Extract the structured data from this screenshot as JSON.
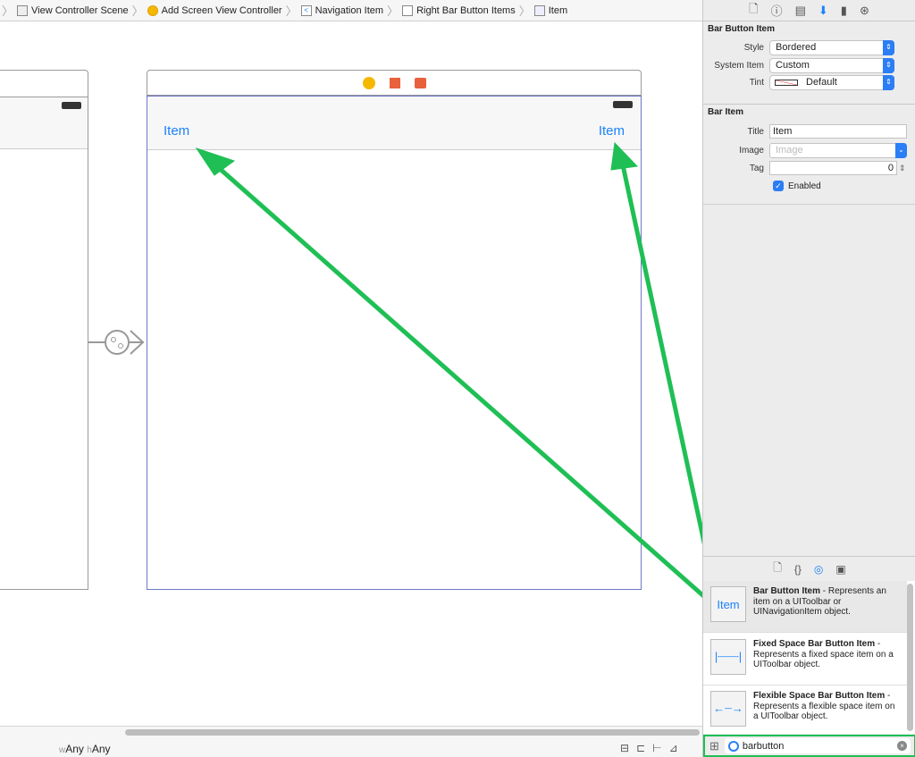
{
  "breadcrumb": [
    "View Controller Scene",
    "Add Screen View Controller",
    "Navigation Item",
    "Right Bar Button Items",
    "Item"
  ],
  "canvas": {
    "left_nav_item": "Item",
    "right_nav_item": "Item"
  },
  "inspector": {
    "tabs": [
      "file-icon",
      "help-icon",
      "identity-icon",
      "attributes-icon",
      "size-icon",
      "connections-icon"
    ],
    "active_tab": "attributes-icon",
    "bar_button_item": {
      "title": "Bar Button Item",
      "style_label": "Style",
      "style": "Bordered",
      "system_item_label": "System Item",
      "system_item": "Custom",
      "tint_label": "Tint",
      "tint": "Default"
    },
    "bar_item": {
      "title": "Bar Item",
      "title_label": "Title",
      "title_value": "Item",
      "image_label": "Image",
      "image_placeholder": "Image",
      "tag_label": "Tag",
      "tag": "0",
      "enabled_label": "Enabled",
      "enabled": true
    }
  },
  "library": {
    "tabs": [
      "file-template-icon",
      "code-snippet-icon",
      "object-library-icon",
      "media-library-icon"
    ],
    "active_tab": "object-library-icon",
    "items": [
      {
        "name": "Bar Button Item",
        "desc": " - Represents an item on a UIToolbar or UINavigationItem object.",
        "thumb": "Item"
      },
      {
        "name": "Fixed Space Bar Button Item",
        "desc": " - Represents a fixed space item on a UIToolbar object."
      },
      {
        "name": "Flexible Space Bar Button Item",
        "desc": " - Represents a flexible space item on a UIToolbar object."
      }
    ],
    "search": "barbutton"
  },
  "bottombar": {
    "w": "w",
    "w_value": "Any",
    "h": "h",
    "h_value": "Any"
  },
  "colors": {
    "accent": "#1a82fb",
    "arrow": "#1fbf55"
  }
}
